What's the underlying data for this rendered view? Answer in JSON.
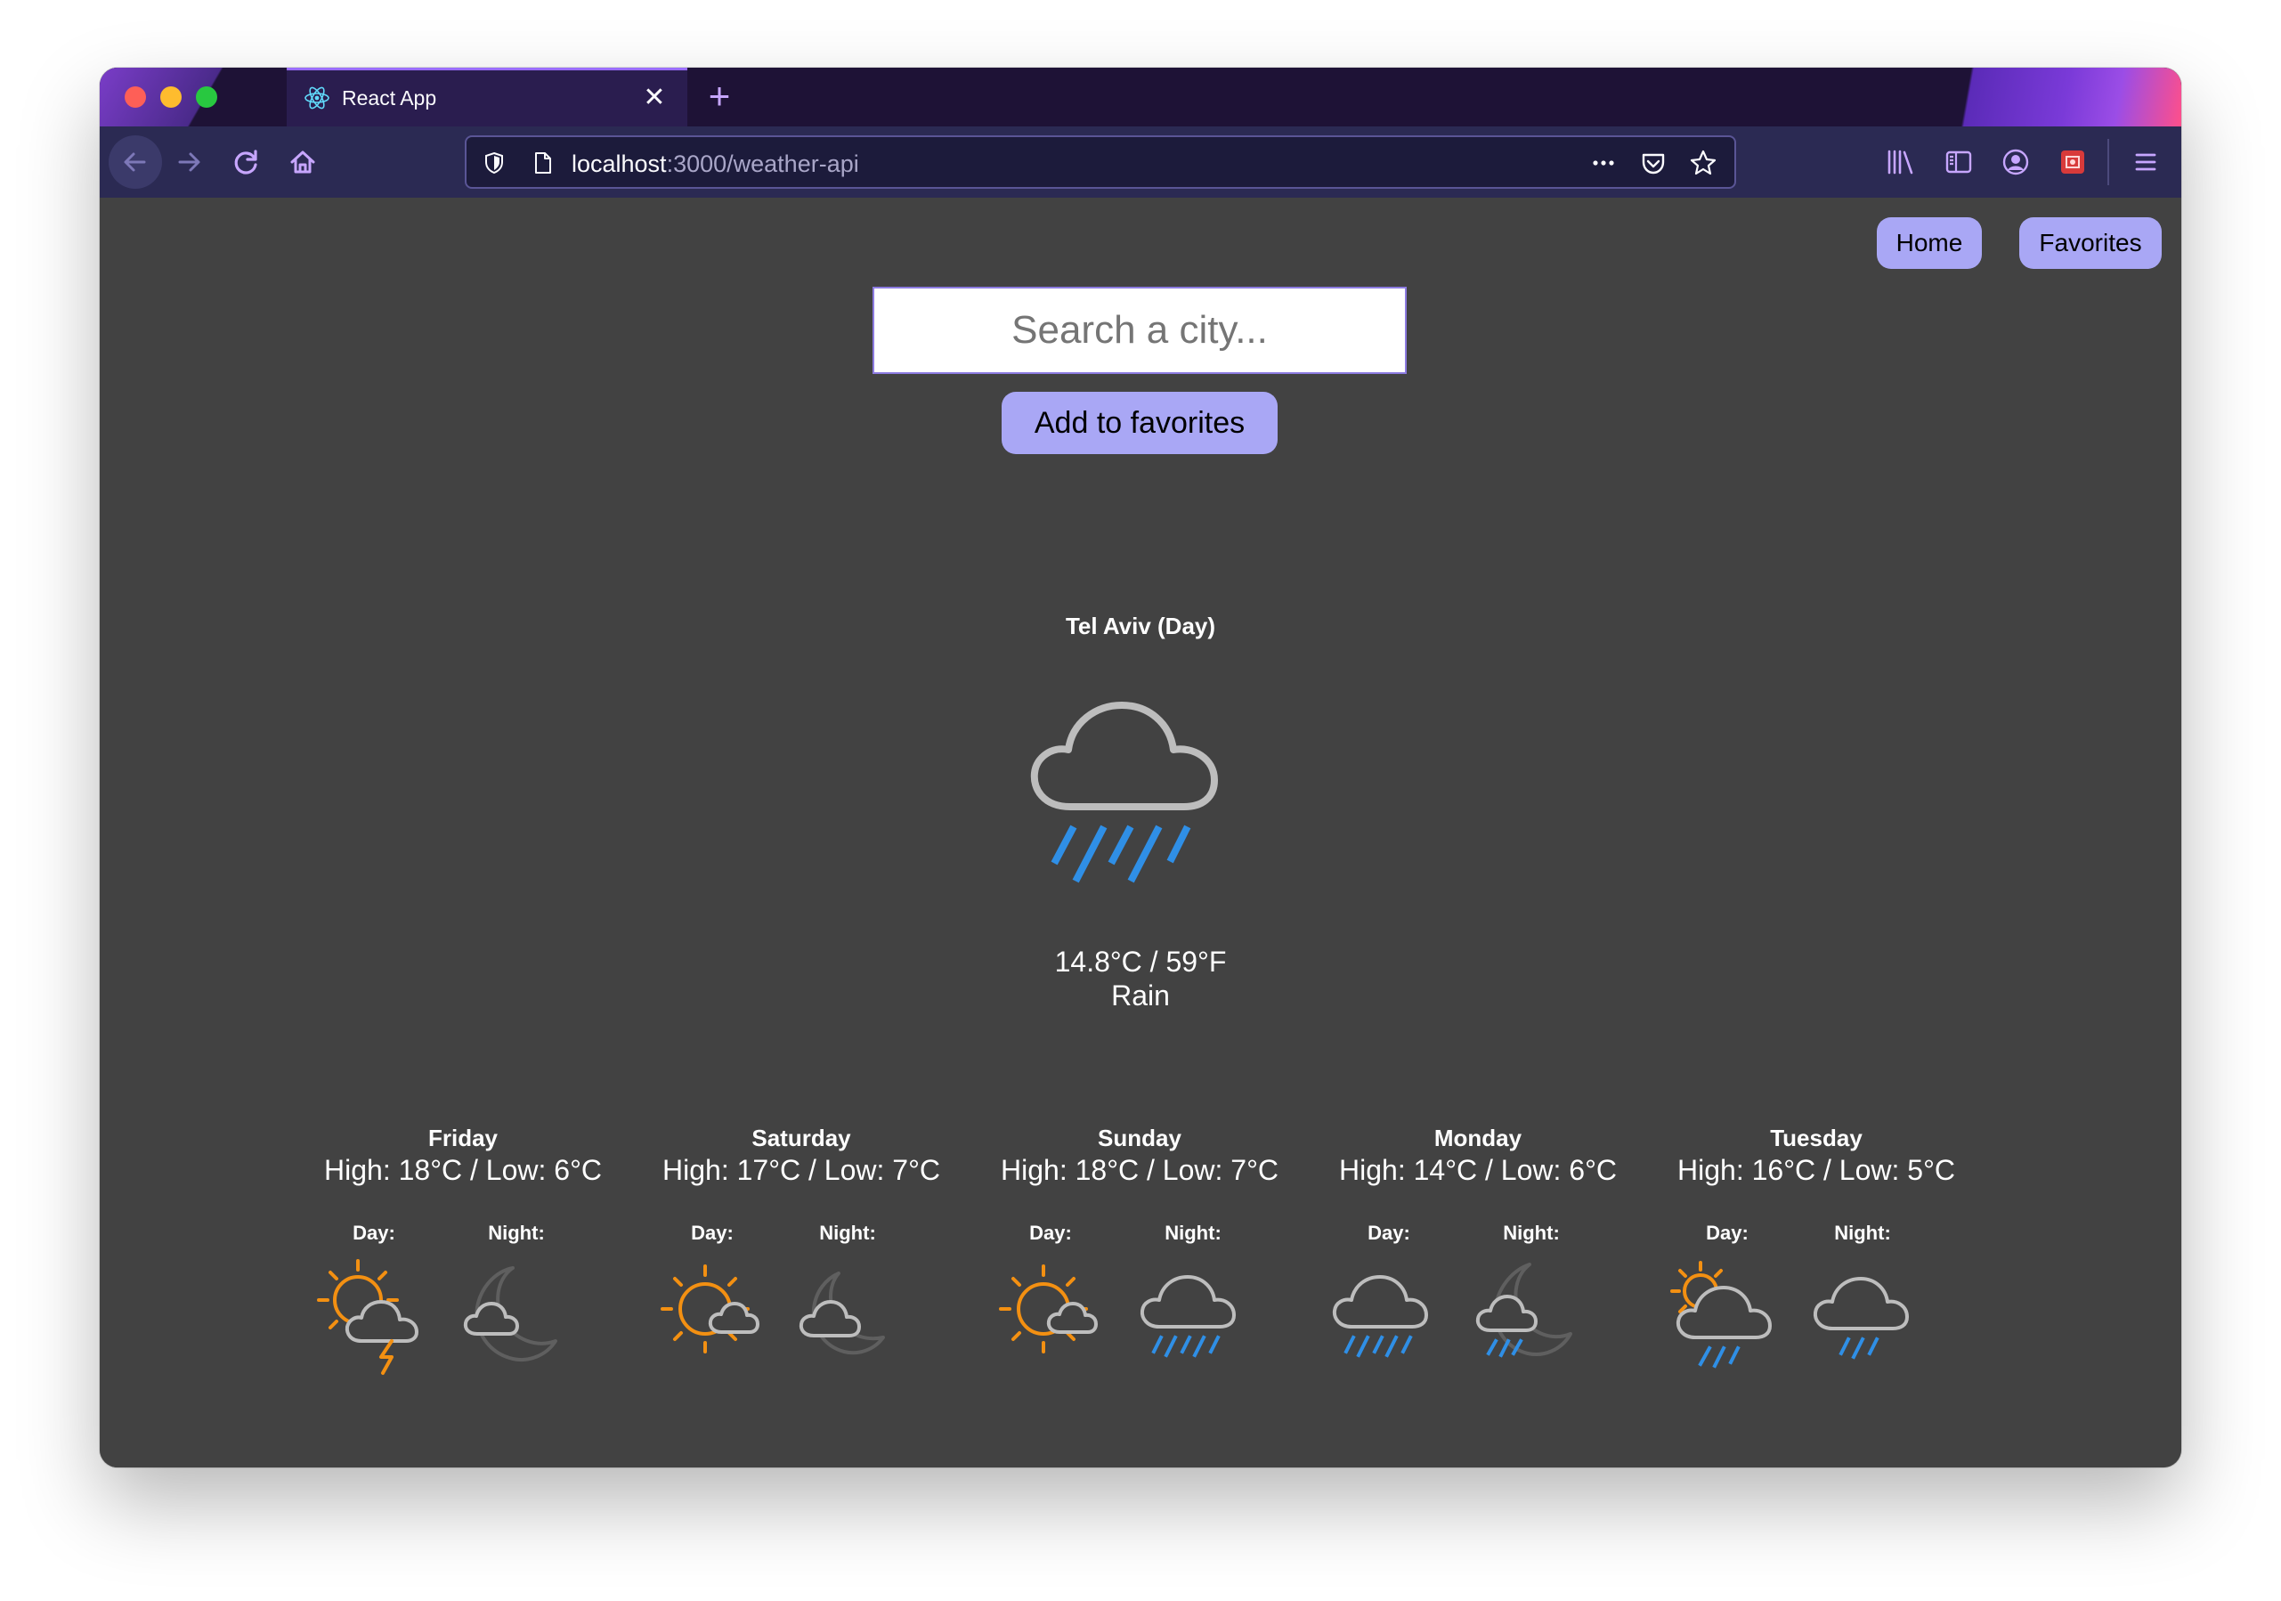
{
  "browser": {
    "tab_title": "React App",
    "url_host": "localhost",
    "url_path": ":3000/weather-api"
  },
  "nav": {
    "home_label": "Home",
    "favorites_label": "Favorites"
  },
  "search": {
    "placeholder": "Search a city...",
    "add_favorites_label": "Add to favorites"
  },
  "current": {
    "city": "Tel Aviv (Day)",
    "temperature": "14.8°C / 59°F",
    "condition": "Rain",
    "icon": "cloud-rain-icon"
  },
  "forecast": {
    "day_label": "Day:",
    "night_label": "Night:",
    "days": [
      {
        "name": "Friday",
        "hilo": "High: 18°C / Low: 6°C",
        "day_icon": "sun-cloud-lightning-icon",
        "night_icon": "moon-cloud-icon"
      },
      {
        "name": "Saturday",
        "hilo": "High: 17°C / Low: 7°C",
        "day_icon": "sun-cloud-icon",
        "night_icon": "moon-cloud-icon"
      },
      {
        "name": "Sunday",
        "hilo": "High: 18°C / Low: 7°C",
        "day_icon": "sun-cloud-icon",
        "night_icon": "cloud-rain-icon"
      },
      {
        "name": "Monday",
        "hilo": "High: 14°C / Low: 6°C",
        "day_icon": "cloud-rain-icon",
        "night_icon": "moon-cloud-rain-icon"
      },
      {
        "name": "Tuesday",
        "hilo": "High: 16°C / Low: 5°C",
        "day_icon": "sun-cloud-rain-icon",
        "night_icon": "cloud-rain-icon"
      }
    ]
  },
  "colors": {
    "background": "#424242",
    "accent_button": "#a9a7f5",
    "rain": "#2f8fe6",
    "sun": "#f39012",
    "cloud": "#bdbdbd"
  }
}
